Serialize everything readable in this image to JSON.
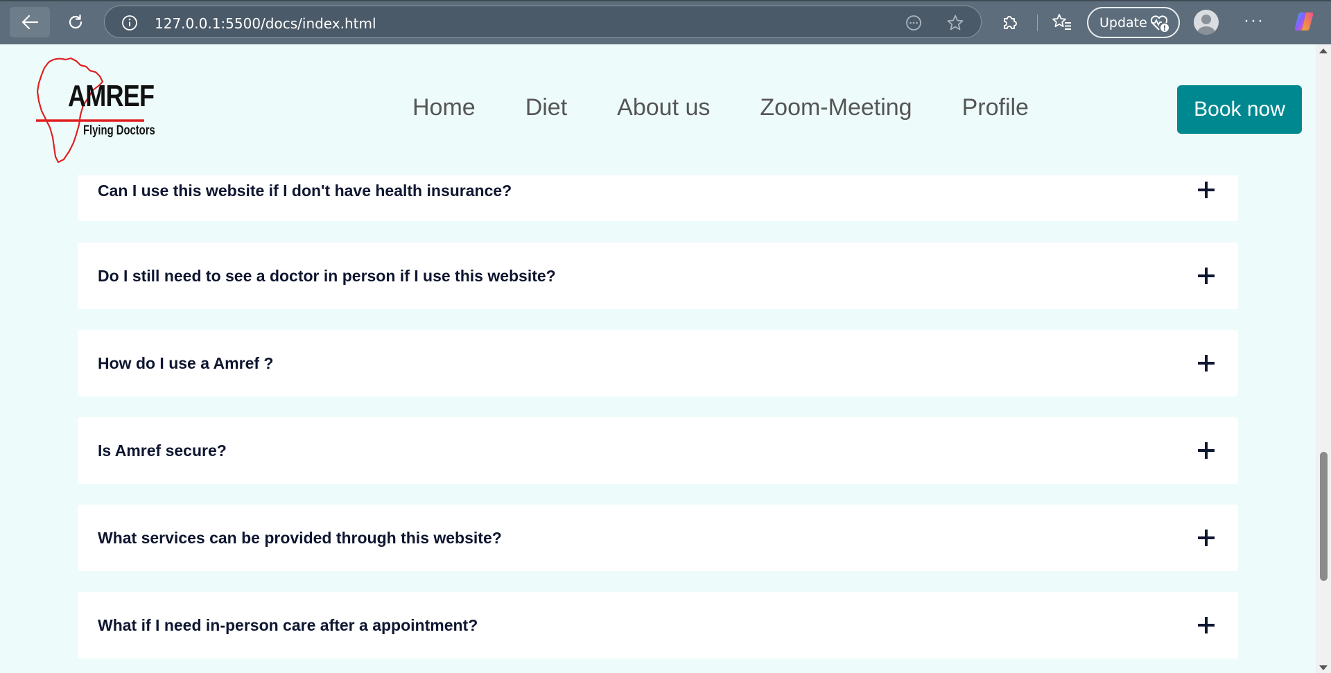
{
  "browser": {
    "url": "127.0.0.1:5500/docs/index.html",
    "update_label": "Update",
    "more_label": "···"
  },
  "site": {
    "logo": {
      "brand": "AMREF",
      "tagline": "Flying Doctors"
    },
    "nav": [
      "Home",
      "Diet",
      "About us",
      "Zoom-Meeting",
      "Profile"
    ],
    "cta_label": "Book now"
  },
  "faq": [
    "Can I use this website if I don't have health insurance?",
    "Do I still need to see a doctor in person if I use this website?",
    "How do I use a Amref ?",
    "Is Amref secure?",
    "What services can be provided through this website?",
    "What if I need in-person care after a appointment?"
  ],
  "colors": {
    "page_background": "#eefbfb",
    "accent": "#008891",
    "question_text": "#0e1630",
    "logo_red": "#e02020"
  }
}
